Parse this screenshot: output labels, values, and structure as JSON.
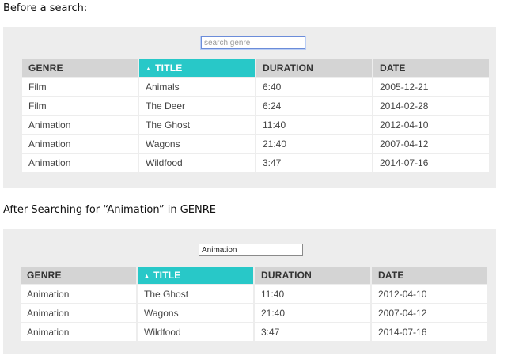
{
  "section1": {
    "caption": "Before a search:",
    "search": {
      "value": "",
      "placeholder": "search genre"
    },
    "headers": [
      "GENRE",
      "TITLE",
      "DURATION",
      "DATE"
    ],
    "sorted_column": "TITLE",
    "sort_arrow": "▲",
    "rows": [
      [
        "Film",
        "Animals",
        "6:40",
        "2005-12-21"
      ],
      [
        "Film",
        "The Deer",
        "6:24",
        "2014-02-28"
      ],
      [
        "Animation",
        "The Ghost",
        "11:40",
        "2012-04-10"
      ],
      [
        "Animation",
        "Wagons",
        "21:40",
        "2007-04-12"
      ],
      [
        "Animation",
        "Wildfood",
        "3:47",
        "2014-07-16"
      ]
    ]
  },
  "section2": {
    "caption": "After Searching for “Animation” in GENRE",
    "search": {
      "value": "Animation",
      "placeholder": "search genre"
    },
    "headers": [
      "GENRE",
      "TITLE",
      "DURATION",
      "DATE"
    ],
    "sorted_column": "TITLE",
    "sort_arrow": "▲",
    "rows": [
      [
        "Animation",
        "The Ghost",
        "11:40",
        "2012-04-10"
      ],
      [
        "Animation",
        "Wagons",
        "21:40",
        "2007-04-12"
      ],
      [
        "Animation",
        "Wildfood",
        "3:47",
        "2014-07-16"
      ]
    ]
  },
  "colors": {
    "panel_bg": "#ededed",
    "header_bg": "#d4d4d4",
    "active_header_bg": "#28c8c8",
    "cell_bg": "#ffffff"
  }
}
